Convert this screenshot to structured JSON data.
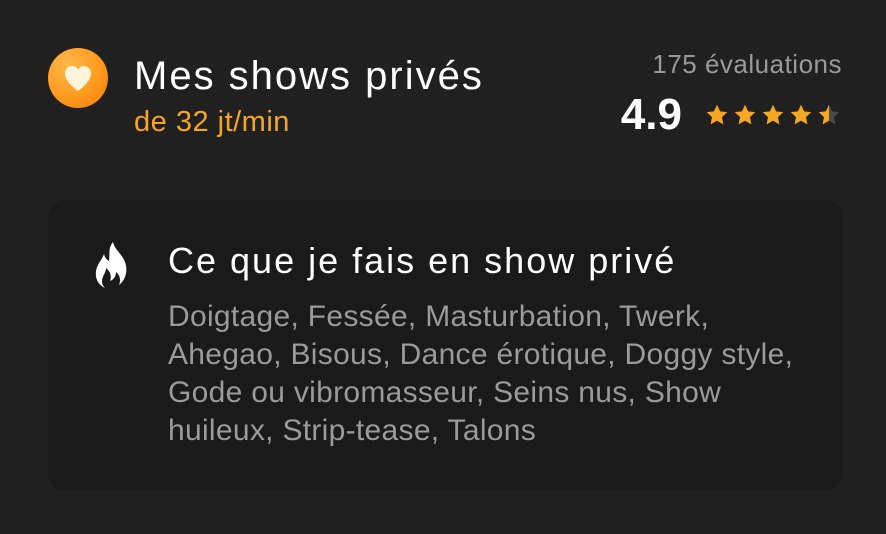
{
  "header": {
    "badge_icon": "heart-icon",
    "badge_color": "#ff9a1f",
    "title": "Mes shows privés",
    "price": "de 32 jt/min",
    "price_color": "#f5a623"
  },
  "rating": {
    "count_label": "175 évaluations",
    "value": "4.9",
    "stars_out_of": 5,
    "stars_filled": 4.5,
    "star_color": "#f5a623"
  },
  "card": {
    "icon": "fire-icon",
    "title": "Ce que je fais en show privé",
    "activities": "Doigtage, Fessée, Masturbation, Twerk, Ahegao, Bisous, Dance érotique, Doggy style, Gode ou vibromasseur, Seins nus, Show huileux, Strip-tease, Talons"
  }
}
